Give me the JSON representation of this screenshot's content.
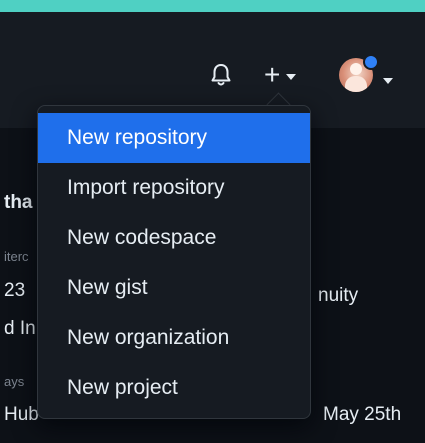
{
  "header": {
    "notifications_icon": "bell-icon",
    "create_glyph": "+",
    "create_icon": "plus-icon",
    "avatar_icon": "user-avatar"
  },
  "create_menu": {
    "active_index": 0,
    "items": [
      {
        "label": "New repository"
      },
      {
        "label": "Import repository"
      },
      {
        "label": "New codespace"
      },
      {
        "label": "New gist"
      },
      {
        "label": "New organization"
      },
      {
        "label": "New project"
      }
    ]
  },
  "background_fragments": {
    "frag1": "tha",
    "frag2": "iterc",
    "frag3": "23",
    "frag4": "nuity",
    "frag5": "d In",
    "frag6": "ays",
    "frag7": "Hub",
    "frag8": "May 25th"
  },
  "colors": {
    "accent_stripe": "#4fd0c3",
    "active_item": "#1f6feb",
    "notification_dot": "#2f81f7"
  }
}
